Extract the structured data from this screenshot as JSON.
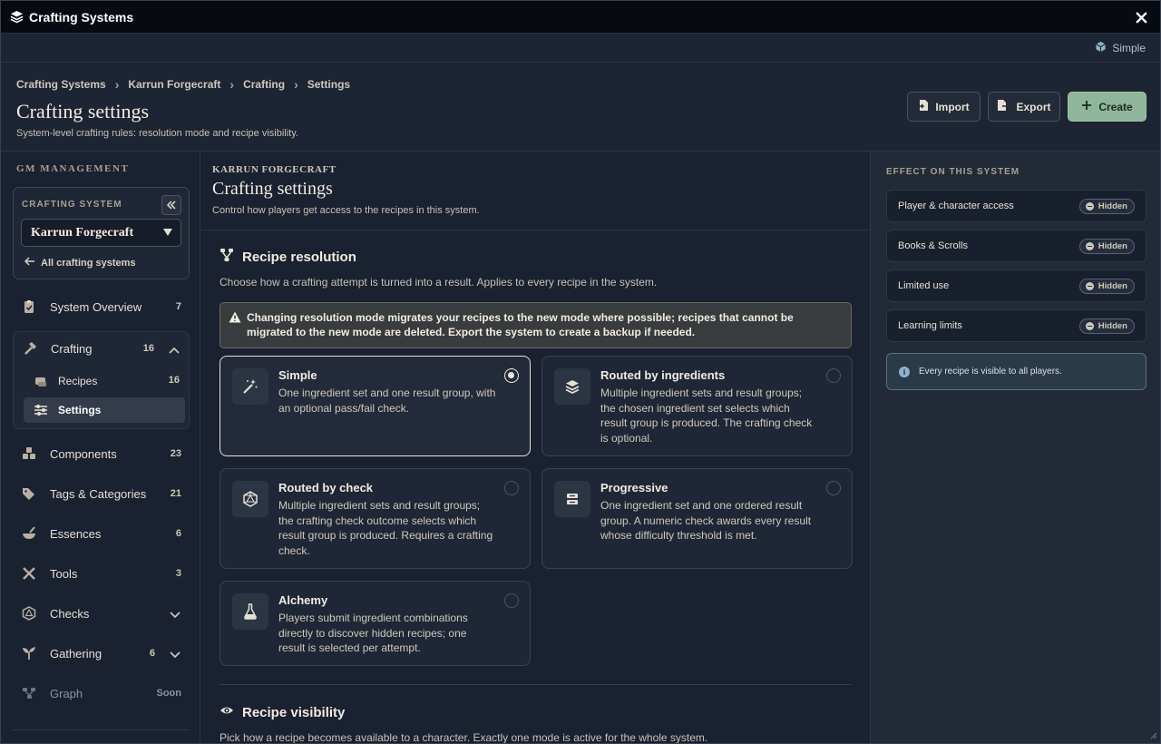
{
  "window": {
    "title": "Crafting Systems"
  },
  "mode_indicator": {
    "label": "Simple"
  },
  "breadcrumb": [
    "Crafting Systems",
    "Karrun Forgecraft",
    "Crafting",
    "Settings"
  ],
  "header": {
    "title": "Crafting settings",
    "subtitle": "System-level crafting rules: resolution mode and recipe visibility.",
    "import_label": "Import",
    "export_label": "Export",
    "create_label": "Create"
  },
  "sidebar": {
    "section_label": "GM MANAGEMENT",
    "system_label": "CRAFTING SYSTEM",
    "system_selected": "Karrun Forgecraft",
    "back_label": "All crafting systems",
    "items": [
      {
        "label": "System Overview",
        "count": "7",
        "icon": "clipboard-icon"
      },
      {
        "label": "Crafting",
        "count": "16",
        "icon": "hammer-icon"
      },
      {
        "label": "Components",
        "count": "23",
        "icon": "boxes-icon"
      },
      {
        "label": "Tags & Categories",
        "count": "21",
        "icon": "tags-icon"
      },
      {
        "label": "Essences",
        "count": "6",
        "icon": "mortar-icon"
      },
      {
        "label": "Tools",
        "count": "3",
        "icon": "tools-icon"
      },
      {
        "label": "Checks",
        "count": "",
        "icon": "dice-icon"
      },
      {
        "label": "Gathering",
        "count": "6",
        "icon": "sprout-icon"
      },
      {
        "label": "Graph",
        "count": "Soon",
        "icon": "graph-icon"
      }
    ],
    "crafting_sub": [
      {
        "label": "Recipes",
        "count": "16",
        "icon": "scroll-icon"
      },
      {
        "label": "Settings",
        "count": "",
        "icon": "sliders-icon"
      }
    ]
  },
  "main": {
    "eyebrow": "KARRUN FORGECRAFT",
    "title": "Crafting settings",
    "subtitle": "Control how players get access to the recipes in this system.",
    "resolution": {
      "title": "Recipe resolution",
      "description": "Choose how a crafting attempt is turned into a result. Applies to every recipe in the system.",
      "warning": "Changing resolution mode migrates your recipes to the new mode where possible; recipes that cannot be migrated to the new mode are deleted. Export the system to create a backup if needed.",
      "selected": "Simple",
      "options": [
        {
          "name": "Simple",
          "description": "One ingredient set and one result group, with an optional pass/fail check.",
          "icon": "wand-icon"
        },
        {
          "name": "Routed by ingredients",
          "description": "Multiple ingredient sets and result groups; the chosen ingredient set selects which result group is produced. The crafting check is optional.",
          "icon": "layers-icon"
        },
        {
          "name": "Routed by check",
          "description": "Multiple ingredient sets and result groups; the crafting check outcome selects which result group is produced. Requires a crafting check.",
          "icon": "d20-icon"
        },
        {
          "name": "Progressive",
          "description": "One ingredient set and one ordered result group. A numeric check awards every result whose difficulty threshold is met.",
          "icon": "stack-icon"
        },
        {
          "name": "Alchemy",
          "description": "Players submit ingredient combinations directly to discover hidden recipes; one result is selected per attempt.",
          "icon": "flask-icon"
        }
      ]
    },
    "visibility": {
      "title": "Recipe visibility",
      "description": "Pick how a recipe becomes available to a character. Exactly one mode is active for the whole system."
    }
  },
  "effect_panel": {
    "title": "EFFECT ON THIS SYSTEM",
    "rows": [
      {
        "label": "Player & character access",
        "status": "Hidden"
      },
      {
        "label": "Books & Scrolls",
        "status": "Hidden"
      },
      {
        "label": "Limited use",
        "status": "Hidden"
      },
      {
        "label": "Learning limits",
        "status": "Hidden"
      }
    ],
    "info": "Every recipe is visible to all players."
  },
  "colors": {
    "accent_create": "#8fb59a",
    "window_bg": "#1a2130",
    "titlebar_bg": "#070a10"
  }
}
